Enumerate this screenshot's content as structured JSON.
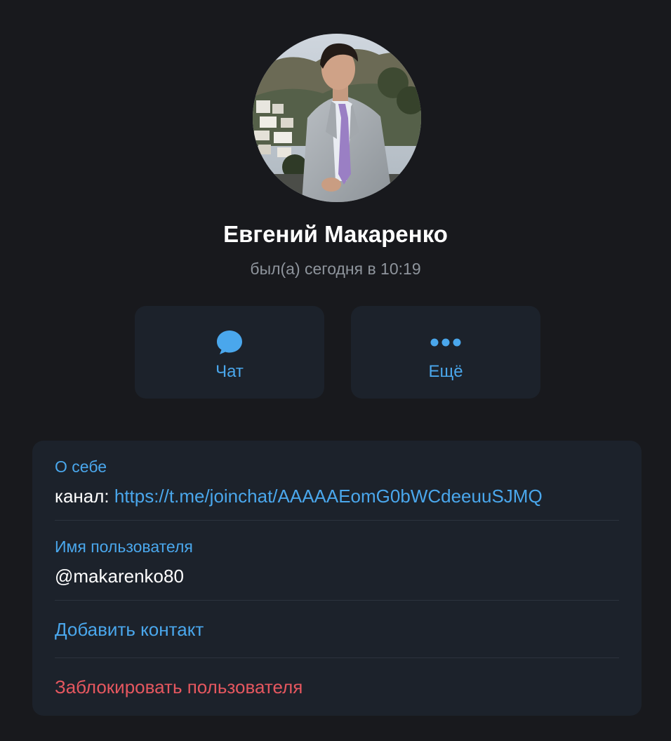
{
  "profile": {
    "name": "Евгений Макаренко",
    "status": "был(а) сегодня в 10:19"
  },
  "actions": {
    "chat_label": "Чат",
    "more_label": "Ещё"
  },
  "about": {
    "caption": "О себе",
    "prefix": "канал: ",
    "link": "https://t.me/joinchat/AAAAAEomG0bWCdeeuuSJMQ"
  },
  "username": {
    "caption": "Имя пользователя",
    "value": "@makarenko80"
  },
  "add_contact": "Добавить контакт",
  "block_user": "Заблокировать пользователя",
  "colors": {
    "background": "#18191d",
    "card": "#1c222b",
    "accent": "#4aa7ec",
    "danger": "#e5575f",
    "muted": "#8e949c"
  },
  "icons": {
    "chat": "chat-bubble-icon",
    "more": "more-dots-icon"
  }
}
